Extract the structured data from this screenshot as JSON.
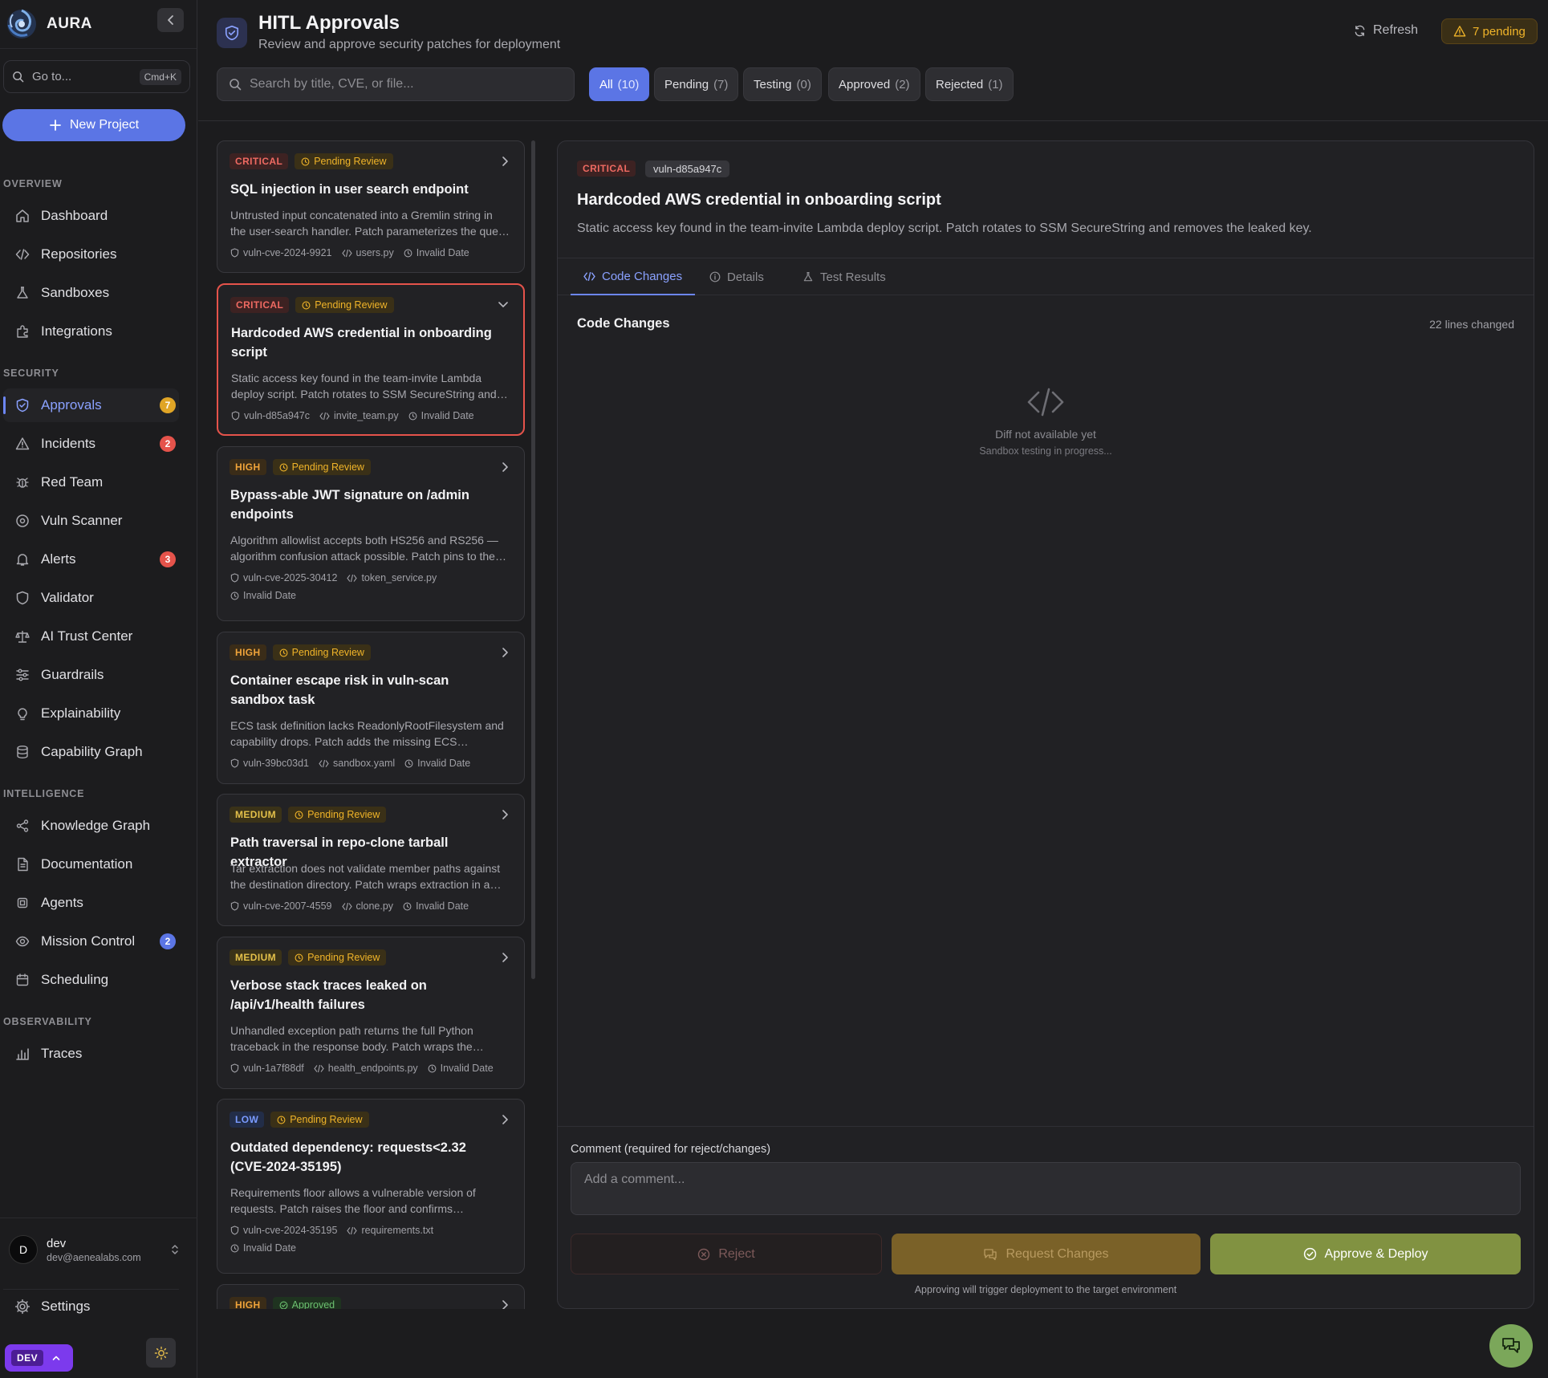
{
  "app": {
    "name": "AURA"
  },
  "sidebar": {
    "goto_label": "Go to...",
    "goto_shortcut": "Cmd+K",
    "new_project": "New Project",
    "sections": {
      "overview": "OVERVIEW",
      "security": "SECURITY",
      "intelligence": "INTELLIGENCE",
      "observability": "OBSERVABILITY"
    },
    "items": {
      "dashboard": "Dashboard",
      "repositories": "Repositories",
      "sandboxes": "Sandboxes",
      "integrations": "Integrations",
      "approvals": "Approvals",
      "incidents": "Incidents",
      "red_team": "Red Team",
      "vuln_scanner": "Vuln Scanner",
      "alerts": "Alerts",
      "validator": "Validator",
      "ai_trust_center": "AI Trust Center",
      "guardrails": "Guardrails",
      "explainability": "Explainability",
      "capability_graph": "Capability Graph",
      "knowledge_graph": "Knowledge Graph",
      "documentation": "Documentation",
      "agents": "Agents",
      "mission_control": "Mission Control",
      "scheduling": "Scheduling",
      "traces": "Traces"
    },
    "badges": {
      "approvals": "7",
      "incidents": "2",
      "alerts": "3",
      "mission_control": "2"
    },
    "badge_colors": {
      "approvals": "#e0a526",
      "incidents": "#e5534b",
      "alerts": "#e5534b",
      "mission_control": "#5b75e5"
    },
    "user": {
      "initial": "D",
      "name": "dev",
      "email": "dev@aenealabs.com"
    },
    "settings": "Settings",
    "env_tag": "DEV"
  },
  "header": {
    "title": "HITL Approvals",
    "subtitle": "Review and approve security patches for deployment",
    "refresh": "Refresh",
    "pending_badge": "7 pending",
    "search_placeholder": "Search by title, CVE, or file...",
    "filters": [
      {
        "label": "All",
        "count": "(10)"
      },
      {
        "label": "Pending",
        "count": "(7)"
      },
      {
        "label": "Testing",
        "count": "(0)"
      },
      {
        "label": "Approved",
        "count": "(2)"
      },
      {
        "label": "Rejected",
        "count": "(1)"
      }
    ]
  },
  "cards": [
    {
      "severity": "CRITICAL",
      "status": "Pending Review",
      "title": "SQL injection in user search endpoint",
      "desc": "Untrusted input concatenated into a Gremlin string in the user-search handler. Patch parameterizes the query and adds input validation.",
      "id": "vuln-cve-2024-9921",
      "file": "users.py",
      "date": "Invalid Date"
    },
    {
      "severity": "CRITICAL",
      "status": "Pending Review",
      "title": "Hardcoded AWS credential in onboarding script",
      "desc": "Static access key found in the team-invite Lambda deploy script. Patch rotates to SSM SecureString and removes the leaked key.",
      "id": "vuln-d85a947c",
      "file": "invite_team.py",
      "date": "Invalid Date"
    },
    {
      "severity": "HIGH",
      "status": "Pending Review",
      "title": "Bypass-able JWT signature on /admin endpoints",
      "desc": "Algorithm allowlist accepts both HS256 and RS256 — algorithm confusion attack possible. Patch pins to the expected algorithm.",
      "id": "vuln-cve-2025-30412",
      "file": "token_service.py",
      "date": "Invalid Date"
    },
    {
      "severity": "HIGH",
      "status": "Pending Review",
      "title": "Container escape risk in vuln-scan sandbox task",
      "desc": "ECS task definition lacks ReadonlyRootFilesystem and capability drops. Patch adds the missing ECS hardening settings.",
      "id": "vuln-39bc03d1",
      "file": "sandbox.yaml",
      "date": "Invalid Date"
    },
    {
      "severity": "MEDIUM",
      "status": "Pending Review",
      "title": "Path traversal in repo-clone tarball extractor",
      "desc": "Tar extraction does not validate member paths against the destination directory. Patch wraps extraction in a safe path check.",
      "id": "vuln-cve-2007-4559",
      "file": "clone.py",
      "date": "Invalid Date"
    },
    {
      "severity": "MEDIUM",
      "status": "Pending Review",
      "title": "Verbose stack traces leaked on /api/v1/health failures",
      "desc": "Unhandled exception path returns the full Python traceback in the response body. Patch wraps the handler with a generic error.",
      "id": "vuln-1a7f88df",
      "file": "health_endpoints.py",
      "date": "Invalid Date"
    },
    {
      "severity": "LOW",
      "status": "Pending Review",
      "title": "Outdated dependency: requests<2.32 (CVE-2024-35195)",
      "desc": "Requirements floor allows a vulnerable version of requests. Patch raises the floor and confirms compatibility.",
      "id": "vuln-cve-2024-35195",
      "file": "requirements.txt",
      "date": "Invalid Date"
    },
    {
      "severity": "HIGH",
      "status": "Approved",
      "title": "",
      "desc": "",
      "id": "",
      "file": "",
      "date": ""
    }
  ],
  "detail": {
    "severity": "CRITICAL",
    "id": "vuln-d85a947c",
    "title": "Hardcoded AWS credential in onboarding script",
    "desc": "Static access key found in the team-invite Lambda deploy script. Patch rotates to SSM SecureString and removes the leaked key.",
    "tabs": [
      "Code Changes",
      "Details",
      "Test Results"
    ],
    "section_title": "Code Changes",
    "lines_changed": "22 lines changed",
    "empty_title": "Diff not available yet",
    "empty_sub": "Sandbox testing in progress...",
    "comment_label": "Comment (required for reject/changes)",
    "comment_placeholder": "Add a comment...",
    "reject": "Reject",
    "request_changes": "Request Changes",
    "approve": "Approve & Deploy",
    "note": "Approving will trigger deployment to the target environment"
  },
  "colors": {
    "accent": "#5b75e5",
    "critical": "#ef6a62",
    "pending": "#f0b429",
    "approve": "#819241"
  }
}
